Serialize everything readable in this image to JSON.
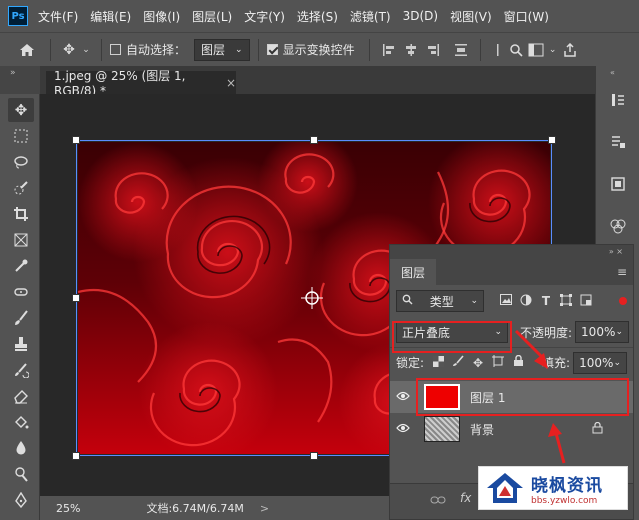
{
  "menu": [
    "文件(F)",
    "编辑(E)",
    "图像(I)",
    "图层(L)",
    "文字(Y)",
    "选择(S)",
    "滤镜(T)",
    "3D(D)",
    "视图(V)",
    "窗口(W)"
  ],
  "app_logo": "Ps",
  "options": {
    "auto_select_label": "自动选择：",
    "auto_select_value": "图层",
    "show_transform_label": "显示变换控件"
  },
  "document": {
    "tab_title": "1.jpeg @ 25% (图层 1, RGB/8) *",
    "close_glyph": "×"
  },
  "status": {
    "zoom": "25%",
    "doc_info": "文档:6.74M/6.74M",
    "arrow": ">"
  },
  "layers_panel": {
    "title": "图层",
    "filter_label": "类型",
    "blend_mode": "正片叠底",
    "opacity_label": "不透明度:",
    "opacity_value": "100%",
    "lock_label": "锁定:",
    "fill_label": "填充:",
    "fill_value": "100%",
    "layers": [
      {
        "name": "图层 1",
        "selected": true,
        "thumb_color": "#ee0000"
      },
      {
        "name": "背景",
        "selected": false,
        "locked": true
      }
    ],
    "footer_icons": [
      "link-icon",
      "fx-icon"
    ]
  },
  "colors": {
    "accent_red": "#e62020",
    "panel_bg": "#535353",
    "canvas_bg": "#282828"
  },
  "watermark": {
    "title": "晓枫资讯",
    "url": "bbs.yzwlo.com"
  }
}
